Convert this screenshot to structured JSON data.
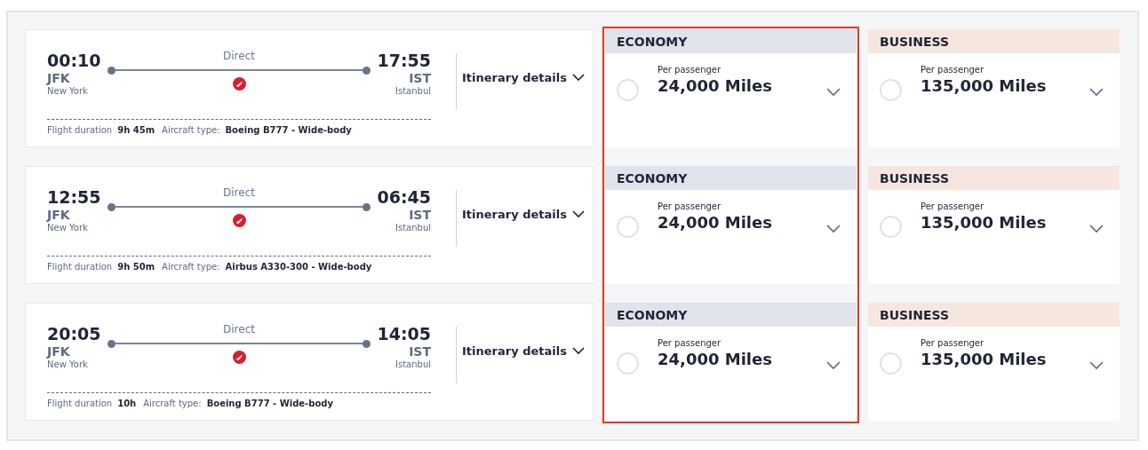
{
  "flights": [
    {
      "depart_time": "00:10",
      "depart_code": "JFK",
      "depart_city": "New York",
      "stop_label": "Direct",
      "arrive_time": "17:55",
      "arrive_code": "IST",
      "arrive_city": "Istanbul",
      "details_label": "Itinerary details",
      "duration_label": "Flight duration",
      "duration": "9h 45m",
      "aircraft_label": "Aircraft type:",
      "aircraft": "Boeing B777 - Wide-body"
    },
    {
      "depart_time": "12:55",
      "depart_code": "JFK",
      "depart_city": "New York",
      "stop_label": "Direct",
      "arrive_time": "06:45",
      "arrive_code": "IST",
      "arrive_city": "Istanbul",
      "details_label": "Itinerary details",
      "duration_label": "Flight duration",
      "duration": "9h 50m",
      "aircraft_label": "Aircraft type:",
      "aircraft": "Airbus A330-300 - Wide-body"
    },
    {
      "depart_time": "20:05",
      "depart_code": "JFK",
      "depart_city": "New York",
      "stop_label": "Direct",
      "arrive_time": "14:05",
      "arrive_code": "IST",
      "arrive_city": "Istanbul",
      "details_label": "Itinerary details",
      "duration_label": "Flight duration",
      "duration": "10h",
      "aircraft_label": "Aircraft type:",
      "aircraft": "Boeing B777 - Wide-body"
    }
  ],
  "fare_columns": [
    {
      "kind": "economy",
      "highlighted": true,
      "fares": [
        {
          "class_label": "ECONOMY",
          "per_label": "Per passenger",
          "miles": "24,000 Miles",
          "selected": false
        },
        {
          "class_label": "ECONOMY",
          "per_label": "Per passenger",
          "miles": "24,000 Miles",
          "selected": false
        },
        {
          "class_label": "ECONOMY",
          "per_label": "Per passenger",
          "miles": "24,000 Miles",
          "selected": false
        }
      ]
    },
    {
      "kind": "business",
      "highlighted": false,
      "fares": [
        {
          "class_label": "BUSINESS",
          "per_label": "Per passenger",
          "miles": "135,000 Miles",
          "selected": false
        },
        {
          "class_label": "BUSINESS",
          "per_label": "Per passenger",
          "miles": "135,000 Miles",
          "selected": false
        },
        {
          "class_label": "BUSINESS",
          "per_label": "Per passenger",
          "miles": "135,000 Miles",
          "selected": false
        }
      ]
    }
  ]
}
